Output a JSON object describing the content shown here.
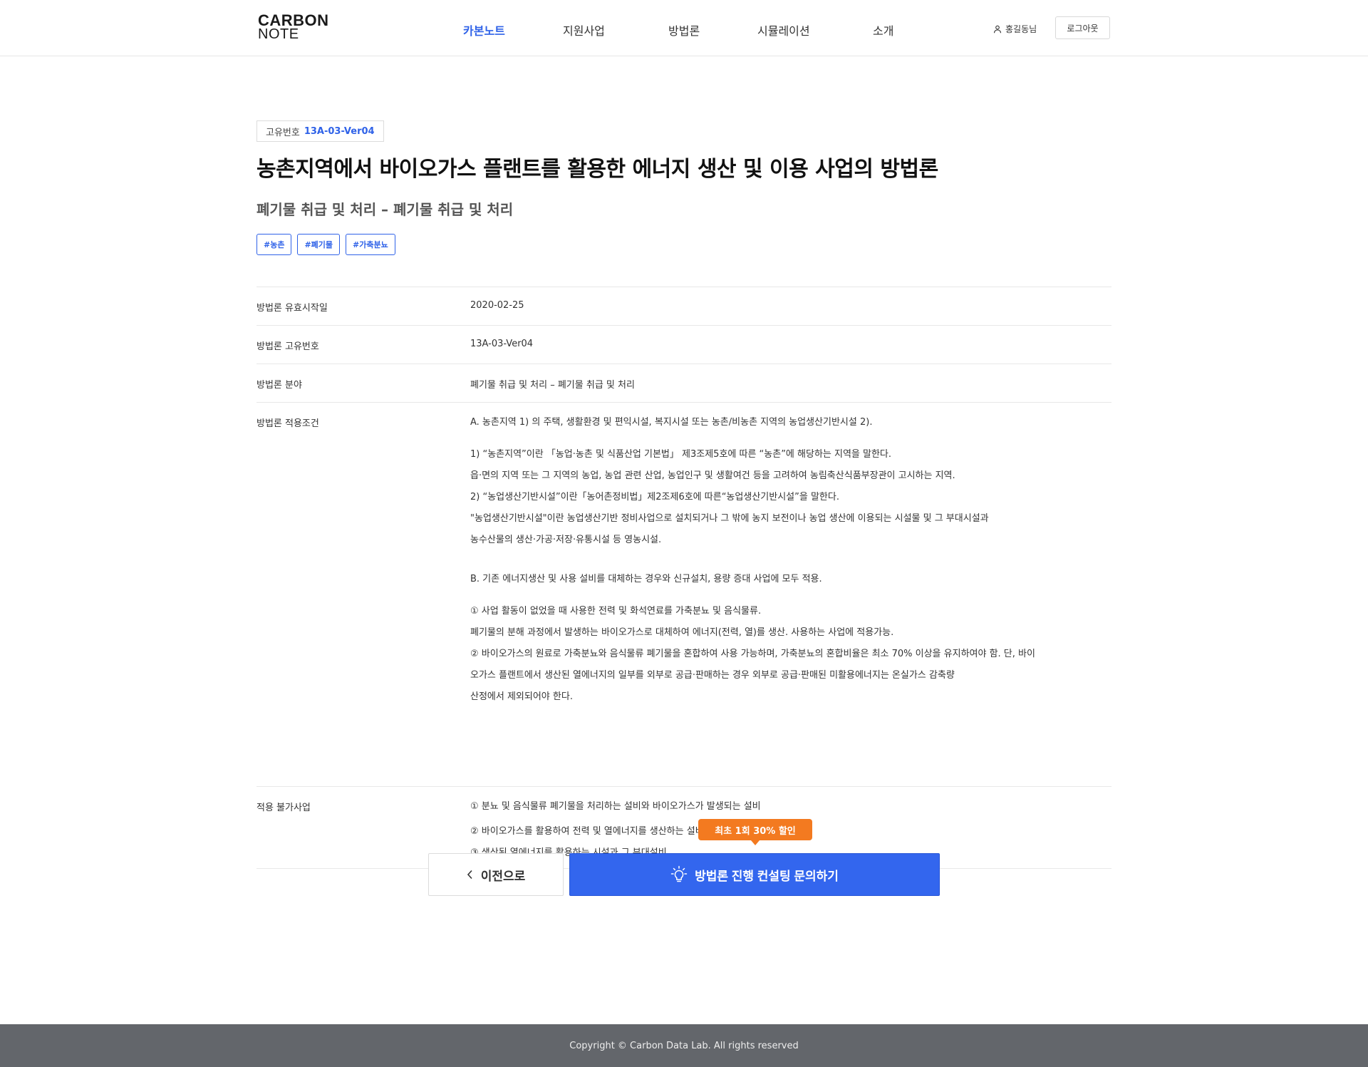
{
  "header": {
    "logo_line1": "CARBON",
    "logo_line2": "NOTE",
    "nav": [
      "카본노트",
      "지원사업",
      "방법론",
      "시뮬레이션",
      "소개"
    ],
    "user_name": "홍길동님",
    "logout_label": "로그아웃"
  },
  "detail": {
    "id_label": "고유번호",
    "id_value": "13A-03-Ver04",
    "title": "농촌지역에서 바이오가스 플랜트를 활용한 에너지 생산 및 이용 사업의 방법론",
    "subtitle": "폐기물 취급 및 처리 – 폐기물 취급 및 처리",
    "tags": [
      "#농촌",
      "#폐기물",
      "#가축분뇨"
    ]
  },
  "table": {
    "rows": [
      {
        "label": "방법론 유효시작일",
        "value": "2020-02-25"
      },
      {
        "label": "방법론 고유번호",
        "value": "13A-03-Ver04"
      },
      {
        "label": "방법론 분야",
        "value": "폐기물 취급 및 처리 – 폐기물 취급 및 처리"
      }
    ],
    "conditions": {
      "label": "방법론 적용조건",
      "a_head": "A. 농촌지역 1) 의 주택, 생활환경 및 편익시설, 복지시설 또는 농촌/비농촌 지역의 농업생산기반시설 2).",
      "a_lines": [
        "1) “농촌지역”이란 「농업·농촌 및 식품산업 기본법」 제3조제5호에 따른 “농촌”에 해당하는 지역을 말한다.",
        "읍·면의 지역 또는 그 지역의 농업, 농업 관련 산업, 농업인구 및 생활여건 등을 고려하여 농림축산식품부장관이 고시하는 지역.",
        "2) “농업생산기반시설”이란「농어촌정비법」제2조제6호에 따른“농업생산기반시설”을 말한다.",
        "\"농업생산기반시설\"이란 농업생산기반 정비사업으로 설치되거나 그 밖에 농지 보전이나 농업 생산에 이용되는 시설물 및 그 부대시설과",
        "농수산물의 생산·가공·저장·유통시설 등 영농시설."
      ],
      "b_head": "B. 기존 에너지생산 및 사용 설비를 대체하는 경우와 신규설치, 용량 증대 사업에 모두 적용.",
      "b_lines": [
        "① 사업 활동이 없었을 때 사용한 전력 및 화석연료를 가축분뇨 및 음식물류.",
        "폐기물의 분해 과정에서 발생하는 바이오가스로 대체하여 에너지(전력, 열)를 생산. 사용하는 사업에 적용가능.",
        "② 바이오가스의 원료로 가축분뇨와 음식물류 폐기물을 혼합하여 사용 가능하며, 가축분뇨의 혼합비율은 최소 70% 이상을 유지하여야 함. 단, 바이",
        "오가스 플랜트에서 생산된 열에너지의 일부를 외부로 공급·판매하는 경우 외부로 공급·판매된 미활용에너지는 온실가스 감축량",
        "산정에서 제외되어야 한다."
      ]
    },
    "exclusions": {
      "label": "적용 불가사업",
      "lines": [
        "① 분뇨 및 음식물류 폐기물을 처리하는 설비와 바이오가스가 발생되는 설비",
        "② 바이오가스를 활용하여 전력 및 열에너지를 생산하는 설비",
        "③ 생산된 열에너지를 활용하는 시설과 그 부대설비"
      ]
    }
  },
  "actions": {
    "badge": "최초 1회 30% 할인",
    "prev_label": "이전으로",
    "cta_label": "방법론 진행 컨설팅 문의하기",
    "accent_color": "#3366ee",
    "badge_color": "#f37a20"
  },
  "footer": {
    "copyright": "Copyright © Carbon Data Lab. All rights reserved"
  },
  "icons": [
    "user-icon",
    "chevron-left-icon",
    "lightbulb-icon"
  ]
}
